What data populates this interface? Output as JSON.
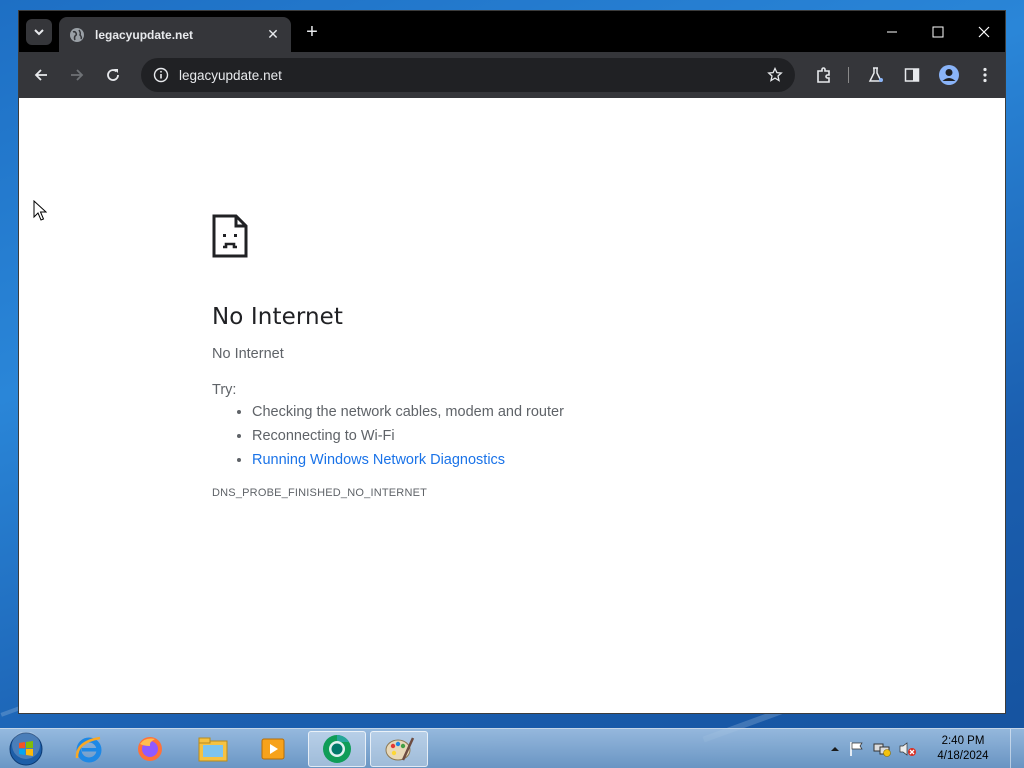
{
  "browser": {
    "tab": {
      "title": "legacyupdate.net"
    },
    "address_bar": {
      "url": "legacyupdate.net"
    }
  },
  "error_page": {
    "heading": "No Internet",
    "subheading": "No Internet",
    "try_label": "Try:",
    "suggestions": [
      "Checking the network cables, modem and router",
      "Reconnecting to Wi-Fi",
      "Running Windows Network Diagnostics"
    ],
    "error_code": "DNS_PROBE_FINISHED_NO_INTERNET"
  },
  "taskbar": {
    "apps": [
      "internet-explorer-icon",
      "firefox-icon",
      "file-explorer-icon",
      "media-player-icon",
      "chrome-icon",
      "paint-icon"
    ],
    "clock": {
      "time": "2:40 PM",
      "date": "4/18/2024"
    }
  },
  "colors": {
    "link": "#1a73e8",
    "toolbar": "#35363a",
    "titlebar": "#000000"
  }
}
